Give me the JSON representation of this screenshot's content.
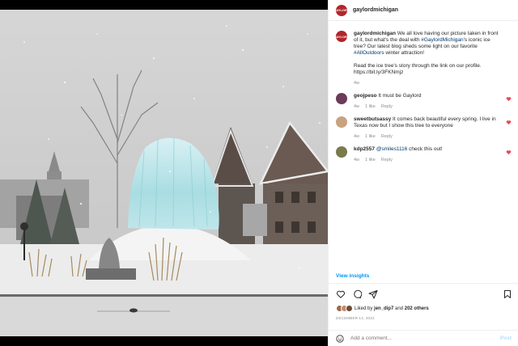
{
  "post": {
    "username": "gaylordmichigan",
    "avatar_text": "GAYLORD",
    "caption": {
      "text_1": "We all love having our picture taken in front of it, but what's the deal with ",
      "hashtag_1": "#GaylordMichigan",
      "text_2": "'s iconic ice tree? Our latest blog sheds some light on our favorite ",
      "hashtag_2": "#AllOutdoors",
      "text_3": " winter attraction!",
      "paragraph_2": "Read the ice tree's story through the link on our profile. https://bit.ly/3FKNmjz",
      "age": "4w"
    },
    "comments": [
      {
        "username": "geojpeso",
        "mention": "",
        "text": " It must be Gaylord",
        "age": "4w",
        "likes": "1 like",
        "reply": "Reply",
        "avatar_color": "#6b3b5a"
      },
      {
        "username": "sweetbutsassy",
        "mention": "",
        "text": " It comes back beautiful every spring. I live in Texas now but I show this tree to everyone",
        "age": "4w",
        "likes": "1 like",
        "reply": "Reply",
        "avatar_color": "#c9a27e"
      },
      {
        "username": "kdp2557",
        "mention": "@smiles1116",
        "text": " check this out!",
        "age": "4w",
        "likes": "1 like",
        "reply": "Reply",
        "avatar_color": "#7a7a4a"
      }
    ],
    "view_insights": "View insights",
    "liked_by_prefix": "Liked by ",
    "liked_by_user": "jen_dip7",
    "liked_by_middle": " and ",
    "liked_by_count": "202 others",
    "date": "DECEMBER 14, 2022",
    "add_comment_placeholder": "Add a comment...",
    "post_label": "Post",
    "heart_color": "#ed4956",
    "link_color": "#00376b",
    "accent_color": "#0095f6",
    "icons": [
      "heart-icon",
      "comment-icon",
      "share-icon",
      "bookmark-icon",
      "emoji-icon"
    ]
  }
}
